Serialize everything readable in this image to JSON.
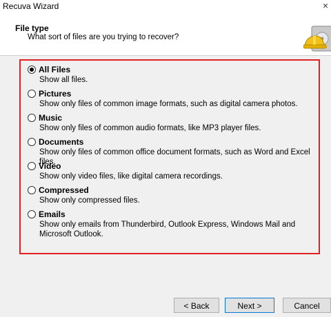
{
  "window": {
    "title": "Recuva Wizard",
    "close_glyph": "×"
  },
  "header": {
    "title": "File type",
    "subtitle": "What sort of files are you trying to recover?",
    "icon": "recuva-hardhat-drive-icon"
  },
  "options": [
    {
      "label": "All Files",
      "description": "Show all files.",
      "selected": true
    },
    {
      "label": "Pictures",
      "description": "Show only files of common image formats, such as digital camera photos.",
      "selected": false
    },
    {
      "label": "Music",
      "description": "Show only files of common audio formats, like MP3 player files.",
      "selected": false
    },
    {
      "label": "Documents",
      "description": "Show only files of common office document formats, such as Word and Excel files.",
      "selected": false
    },
    {
      "label": "Video",
      "description": "Show only video files, like digital camera recordings.",
      "selected": false
    },
    {
      "label": "Compressed",
      "description": "Show only compressed files.",
      "selected": false
    },
    {
      "label": "Emails",
      "description": "Show only emails from Thunderbird, Outlook Express, Windows Mail and Microsoft Outlook.",
      "selected": false
    }
  ],
  "buttons": {
    "back": "< Back",
    "next": "Next >",
    "cancel": "Cancel"
  },
  "colors": {
    "highlight_border": "#e02020",
    "primary_button_border": "#0078d7",
    "body_background": "#f0f0f0"
  }
}
